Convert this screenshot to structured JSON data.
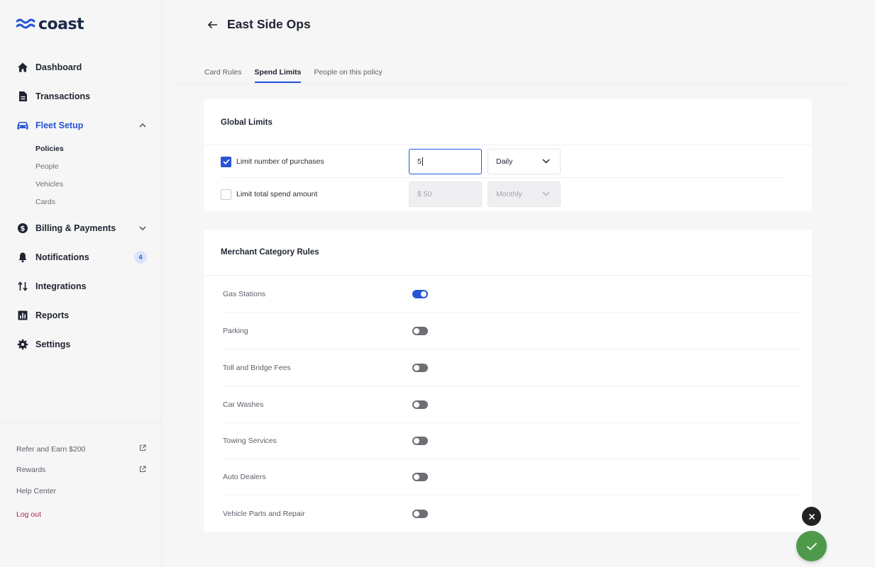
{
  "brand": {
    "name": "coast",
    "accent": "#2754d6",
    "logo_color": "#1b2a4a"
  },
  "sidebar": {
    "items": [
      {
        "label": "Dashboard",
        "icon": "home-icon"
      },
      {
        "label": "Transactions",
        "icon": "document-icon"
      },
      {
        "label": "Fleet Setup",
        "icon": "car-icon",
        "expanded": true,
        "active": true,
        "subitems": [
          "Policies",
          "People",
          "Vehicles",
          "Cards"
        ],
        "active_subitem": "Policies"
      },
      {
        "label": "Billing & Payments",
        "icon": "dollar-icon",
        "expanded": false
      },
      {
        "label": "Notifications",
        "icon": "bell-icon",
        "badge": "4"
      },
      {
        "label": "Integrations",
        "icon": "sort-arrows-icon"
      },
      {
        "label": "Reports",
        "icon": "bar-chart-icon"
      },
      {
        "label": "Settings",
        "icon": "gear-icon"
      }
    ],
    "footer": {
      "refer": "Refer and Earn $200",
      "rewards": "Rewards",
      "help": "Help Center",
      "logout": "Log out"
    }
  },
  "header": {
    "title": "East Side Ops"
  },
  "tabs": [
    {
      "label": "Card Rules",
      "active": false
    },
    {
      "label": "Spend Limits",
      "active": true
    },
    {
      "label": "People on this policy",
      "active": false
    }
  ],
  "global_limits": {
    "title": "Global Limits",
    "rows": [
      {
        "label": "Limit number of purchases",
        "checked": true,
        "value": "5",
        "period": "Daily",
        "enabled": true
      },
      {
        "label": "Limit total spend amount",
        "checked": false,
        "placeholder": "$ 50",
        "period": "Monthly",
        "enabled": false
      }
    ]
  },
  "merchant_rules": {
    "title": "Merchant Category Rules",
    "rows": [
      {
        "label": "Gas Stations",
        "on": true
      },
      {
        "label": "Parking",
        "on": false
      },
      {
        "label": "Toll and Bridge Fees",
        "on": false
      },
      {
        "label": "Car Washes",
        "on": false
      },
      {
        "label": "Towing Services",
        "on": false
      },
      {
        "label": "Auto Dealers",
        "on": false
      },
      {
        "label": "Vehicle Parts and Repair",
        "on": false
      }
    ]
  },
  "colors": {
    "toggle_off": "#6d6f75",
    "confirm": "#4e9a4a",
    "logout": "#b3264b"
  }
}
